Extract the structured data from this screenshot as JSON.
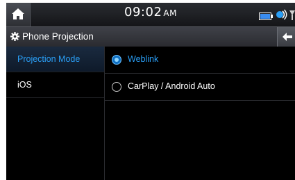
{
  "status_bar": {
    "time": "09:02",
    "ampm": "AM",
    "icons": [
      "battery-icon",
      "phone-connected-icon",
      "signal-icon"
    ]
  },
  "title_bar": {
    "title": "Phone Projection",
    "icon": "gear-icon"
  },
  "sidebar": {
    "items": [
      {
        "label": "Projection Mode",
        "active": true
      },
      {
        "label": "iOS",
        "active": false
      }
    ]
  },
  "main": {
    "options": [
      {
        "label": "Weblink",
        "selected": true
      },
      {
        "label": "CarPlay / Android Auto",
        "selected": false
      }
    ]
  },
  "colors": {
    "accent": "#2a9ef5",
    "background": "#000000"
  }
}
